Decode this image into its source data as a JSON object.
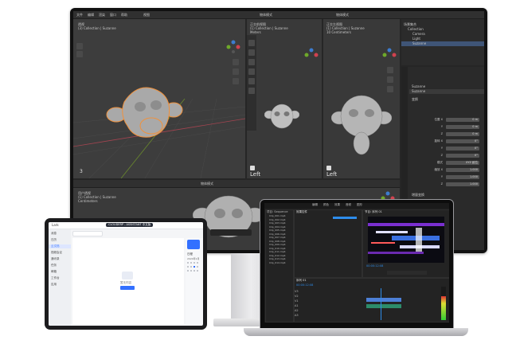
{
  "monitor": {
    "blender": {
      "header_menus": [
        "文件",
        "编辑",
        "渲染",
        "窗口",
        "帮助"
      ],
      "view_menu": "视图",
      "object_mode": "物体模式",
      "viewport_main": {
        "title": "透视",
        "collection": "(3) Collection | Suzanne",
        "frame": "3"
      },
      "viewport_mid": {
        "title": "正交前视图",
        "collection": "(1) Collection | Suzanne",
        "sub": "Meters",
        "axis_label": "Left"
      },
      "viewport_right": {
        "title": "正交左视图",
        "collection": "(1) Collection | Suzanne",
        "sub": "10 Centimeters",
        "axis_label": "Left"
      },
      "viewport_bottom": {
        "title": "用户透视",
        "collection": "(1) Collection | Suzanne",
        "sub": "Centimeters"
      },
      "outliner": {
        "title": "场景集合",
        "items": [
          "Collection",
          "Camera",
          "Light",
          "Suzanne"
        ],
        "selected_index": 3
      },
      "properties": {
        "object_name": "Suzanne",
        "object_name2": "Suzanne",
        "section_transform": "变换",
        "fields": [
          {
            "label": "位置 X",
            "value": "0 m"
          },
          {
            "label": "Y",
            "value": "0 m"
          },
          {
            "label": "Z",
            "value": "0 m"
          },
          {
            "label": "旋转 X",
            "value": "0°"
          },
          {
            "label": "Y",
            "value": "0°"
          },
          {
            "label": "Z",
            "value": "0°"
          },
          {
            "label": "模式",
            "value": "XYZ 欧拉"
          },
          {
            "label": "缩放 X",
            "value": "1.000"
          },
          {
            "label": "Y",
            "value": "1.000"
          },
          {
            "label": "Z",
            "value": "1.000"
          }
        ],
        "section_delta": "增量变换",
        "section_relations": "关系"
      }
    }
  },
  "ipad": {
    "app_title": "Lark",
    "top_banner": "CLOUDERP - ASSISTANT 中文版",
    "search_placeholder": "搜索",
    "sidebar_items": [
      "消息",
      "日历",
      "云文档",
      "视频会议",
      "通讯录",
      "任务",
      "邮箱",
      "工作台",
      "应用"
    ],
    "empty_title": "暂无内容",
    "empty_button": "新建",
    "calendar_title": "日程",
    "calendar_month": "2024年1月"
  },
  "laptop": {
    "premiere": {
      "tabs": [
        "编辑",
        "颜色",
        "效果",
        "音频",
        "图形"
      ],
      "project_title": "项目: Sequence",
      "source_tab": "效果控件",
      "program_tab": "节目: 序列 01",
      "timecode_program": "00:00:12:08",
      "timecode_timeline": "00:00:12:08",
      "timeline_title": "序列 01",
      "tracks_video": [
        "V3",
        "V2",
        "V1"
      ],
      "tracks_audio": [
        "A1",
        "A2",
        "A3"
      ],
      "project_files": [
        "Clip_001.mp4",
        "Clip_002.mp4",
        "Clip_003.mp4",
        "Clip_004.mp4",
        "Clip_005.mp4",
        "Clip_006.mp4",
        "Clip_007.mp4",
        "Clip_008.mp4",
        "Clip_009.mp4",
        "Clip_010.mp4",
        "Clip_011.mp4",
        "Clip_012.mp4",
        "Clip_013.mp4",
        "Clip_014.mp4"
      ]
    }
  },
  "colors": {
    "blender_bg": "#3d3d3d",
    "blender_select": "#3f5577",
    "suzanne": "#a9a9a9",
    "outline_orange": "#f0913c",
    "axis_red": "#d0424f",
    "axis_green": "#6ea82a",
    "axis_blue": "#3c7ccf",
    "premiere_accent": "#2d8ceb",
    "lark_blue": "#3370ff"
  }
}
